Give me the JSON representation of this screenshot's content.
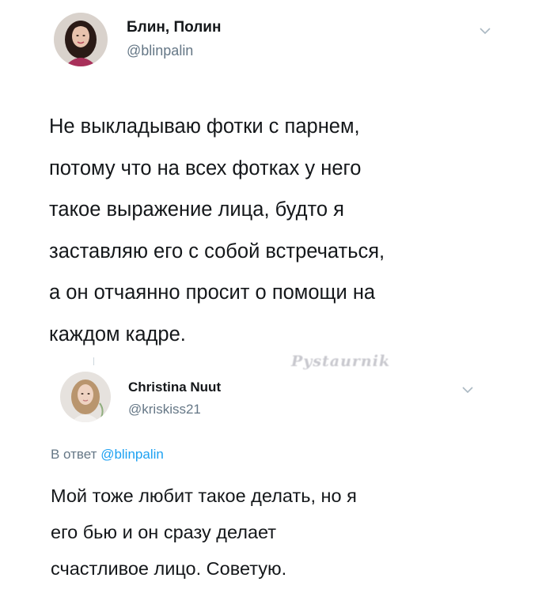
{
  "tweets": [
    {
      "author_name": "Блин, Полин",
      "author_handle": "@blinpalin",
      "text_lines": [
        "Не выкладываю фотки с парнем,",
        "потому что на всех фотках у него",
        "такое выражение лица, будто я",
        "заставляю его с собой встречаться,",
        "а он отчаянно просит о помощи на",
        "каждом кадре."
      ]
    },
    {
      "author_name": "Christina Nuut",
      "author_handle": "@kriskiss21",
      "reply_prefix": "В ответ",
      "reply_mention": "@blinpalin",
      "text_lines": [
        "Мой тоже любит такое делать, но я",
        "его бью и он сразу делает",
        "счастливое лицо. Советую."
      ]
    }
  ],
  "watermark": "Pystaurnik",
  "icons": {
    "menu": "chevron-down-icon",
    "avatar": "avatar"
  },
  "colors": {
    "text": "#14171a",
    "secondary": "#657786",
    "link": "#1da1f2"
  }
}
